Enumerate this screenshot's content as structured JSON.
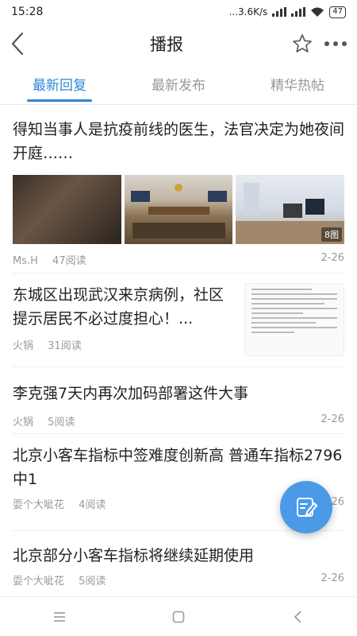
{
  "status_bar": {
    "time": "15:28",
    "speed": "...3.6K/s",
    "battery": "47"
  },
  "header": {
    "title": "播报"
  },
  "tabs": [
    {
      "label": "最新回复",
      "active": true
    },
    {
      "label": "最新发布",
      "active": false
    },
    {
      "label": "精华热帖",
      "active": false
    }
  ],
  "feed": [
    {
      "title": "得知当事人是抗疫前线的医生，法官决定为她夜间开庭……",
      "image_count": "8图",
      "author": "Ms.H",
      "reads": "47阅读",
      "date": "2-26"
    },
    {
      "title": "东城区出现武汉来京病例，社区提示居民不必过度担心！...",
      "author": "火锅",
      "reads": "31阅读",
      "date": ""
    },
    {
      "title": "李克强7天内再次加码部署这件大事",
      "author": "火锅",
      "reads": "5阅读",
      "date": "2-26"
    },
    {
      "title": "北京小客车指标中签难度创新高 普通车指标2796中1",
      "author": "耍个大呲花",
      "reads": "4阅读",
      "date": "2-26"
    },
    {
      "title": "北京部分小客车指标将继续延期使用",
      "author": "耍个大呲花",
      "reads": "5阅读",
      "date": "2-26"
    }
  ],
  "colors": {
    "accent": "#2f86d8",
    "fab": "#4a9ae8"
  }
}
